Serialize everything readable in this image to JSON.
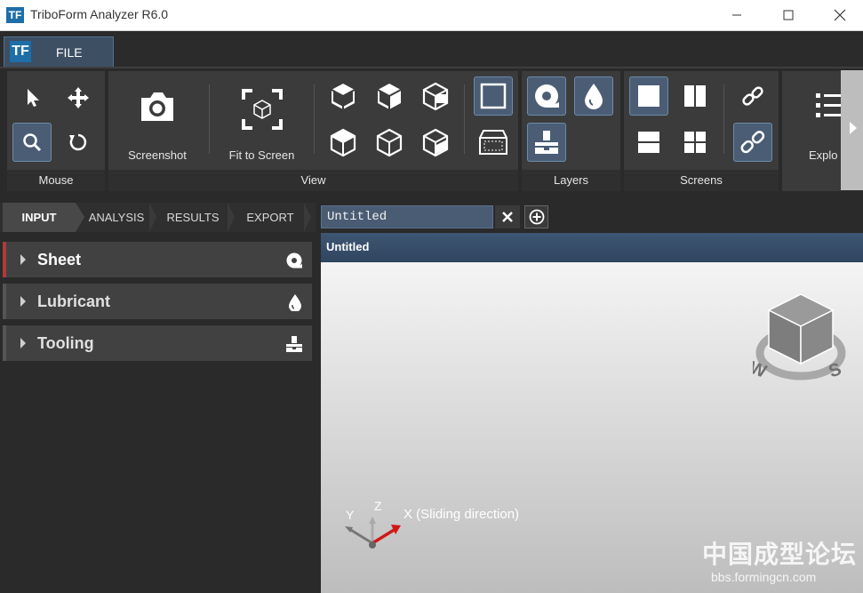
{
  "window": {
    "title": "TriboForm Analyzer R6.0",
    "logo_text": "TF"
  },
  "menu": {
    "file_logo": "TF",
    "file_label": "FILE"
  },
  "ribbon": {
    "groups": {
      "mouse": "Mouse",
      "view": "View",
      "layers": "Layers",
      "screens": "Screens"
    },
    "screenshot_label": "Screenshot",
    "fit_label": "Fit to Screen",
    "explode_label": "Explo"
  },
  "nav": {
    "tabs": [
      "INPUT",
      "ANALYSIS",
      "RESULTS",
      "EXPORT"
    ]
  },
  "sections": [
    {
      "label": "Sheet",
      "icon": "sheet-coil-icon"
    },
    {
      "label": "Lubricant",
      "icon": "lubricant-drop-icon"
    },
    {
      "label": "Tooling",
      "icon": "tooling-icon"
    }
  ],
  "document": {
    "tab_label": "Untitled",
    "viewport_title": "Untitled"
  },
  "axes": {
    "y": "Y",
    "z": "Z",
    "x": "X (Sliding direction)"
  },
  "viewcube": {
    "compass_w": "W",
    "compass_s": "S"
  },
  "watermark": {
    "cn": "中国成型论坛",
    "url": "bbs.formingcn.com"
  },
  "colors": {
    "accent": "#4a5d75",
    "brand": "#1e6ea8",
    "viewport_header": "#3e5673"
  }
}
